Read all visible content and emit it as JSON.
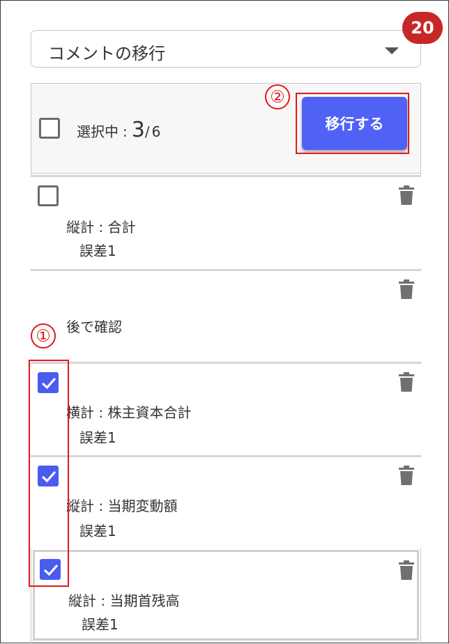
{
  "dropdown": {
    "selected": "コメントの移行"
  },
  "badge": {
    "count": "20"
  },
  "header": {
    "selected_label": "選択中",
    "separator": ":",
    "selected_count": "3",
    "slash": "/",
    "total_count": "6",
    "migrate_button_label": "移行する"
  },
  "annotations": {
    "marker1": "①",
    "marker2": "②"
  },
  "comments": [
    {
      "line1": "縦計 : 合計",
      "line2": "誤差1",
      "checked": false,
      "has_checkbox": true
    },
    {
      "line1": "後で確認",
      "line2": "",
      "checked": false,
      "has_checkbox": false
    },
    {
      "line1": "横計 : 株主資本合計",
      "line2": "誤差1",
      "checked": true,
      "has_checkbox": true
    },
    {
      "line1": "縦計 : 当期変動額",
      "line2": "誤差1",
      "checked": true,
      "has_checkbox": true
    },
    {
      "line1": "縦計 : 当期首残高",
      "line2": "誤差1",
      "checked": true,
      "has_checkbox": true
    }
  ],
  "colors": {
    "accent": "#4a5cf0",
    "badge": "#c62828",
    "highlight": "#e21818"
  },
  "icons": [
    "chevron-down-icon",
    "checkmark-icon",
    "trash-icon"
  ]
}
